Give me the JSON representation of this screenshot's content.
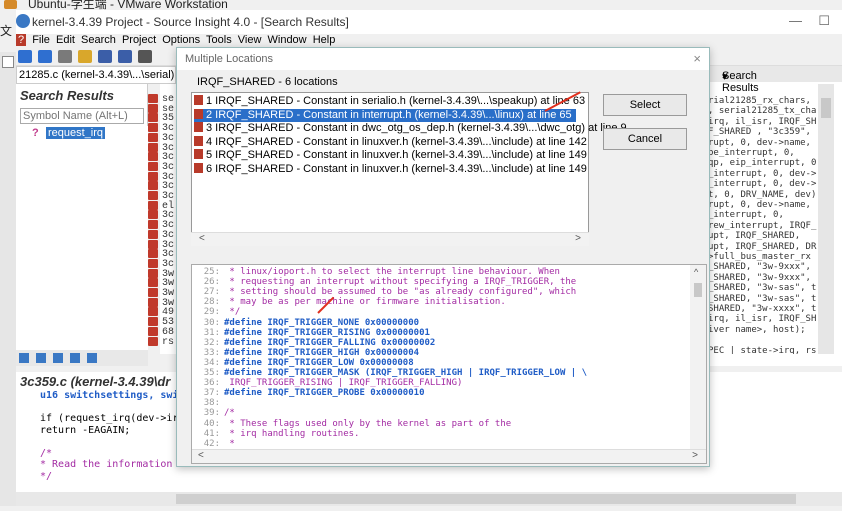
{
  "vm": {
    "title": "Ubuntu-学生端 - VMware Workstation"
  },
  "side_char": "文",
  "window": {
    "title": "kernel-3.4.39 Project - Source Insight 4.0 - [Search Results]",
    "minimize": "—",
    "maximize": "☐"
  },
  "menu": {
    "file_marker": "?",
    "items": [
      "File",
      "Edit",
      "Search",
      "Project",
      "Options",
      "Tools",
      "View",
      "Window",
      "Help"
    ]
  },
  "project_tab": "21285.c (kernel-3.4.39\\...\\serial)",
  "search_panel": {
    "title": "Search Results",
    "placeholder": "Symbol Name (Alt+L)",
    "item_icon": "?",
    "item_label": "request_irq"
  },
  "result_codes": [
    "se",
    "se",
    "35",
    "3c",
    "3c",
    "3c",
    "3c",
    "3c",
    "3c",
    "3c",
    "3c",
    "el",
    "3c",
    "3c",
    "3c",
    "3c",
    "3c",
    "3c",
    "3w",
    "3w",
    "3w",
    "3w",
    "49",
    "53",
    "68",
    "rs"
  ],
  "right_panel": {
    "tab_label": "Search Results",
    "tab_close": "×",
    "tab_menu": "▾",
    "code_lines": [
      "rial21285_rx_chars,",
      ", serial21285_tx_cha",
      "irq, il_isr, IRQF_SH",
      "F_SHARED , \"3c359\",",
      "rupt, 0, dev->name,",
      "be_interrupt, 0,",
      "qp, eip_interrupt, 0",
      "_interrupt, 0, dev->",
      "_interrupt, 0, dev->",
      "t, 0, DRV_NAME, dev)",
      "rupt, 0, dev->name,",
      "_interrupt, 0,",
      "rew_interrupt, IRQF_",
      "upt, IRQF_SHARED,",
      "upt, IRQF_SHARED, DR",
      ">full_bus_master_rx",
      "_SHARED, \"3w-9xxx\",",
      "_SHARED, \"3w-9xxx\",",
      "_SHARED, \"3w-sas\", t",
      "_SHARED, \"3w-sas\", t",
      "SHARED, \"3w-xxxx\", t",
      "irq, il_isr, IRQF_SH",
      "iver name>, host);",
      "",
      "PEC | state->irq, rs"
    ]
  },
  "editor": {
    "title": "3c359.c (kernel-3.4.39\\dr",
    "lines": [
      {
        "text": "u16 switchsettings, switchs",
        "kind": "decl"
      },
      {
        "text": "",
        "kind": "blank"
      },
      {
        "text": "if (request_irq(dev->irq, x",
        "kind": "code"
      },
      {
        "text": "    return -EAGAIN;",
        "kind": "code"
      },
      {
        "text": "",
        "kind": "blank"
      },
      {
        "text": "/*",
        "kind": "comment"
      },
      {
        "text": " * Read the information fro",
        "kind": "comment"
      },
      {
        "text": " */",
        "kind": "comment"
      }
    ]
  },
  "dialog": {
    "title": "Multiple Locations",
    "close": "×",
    "heading": "IRQF_SHARED - 6 locations",
    "locations": [
      "1 IRQF_SHARED - Constant in serialio.h (kernel-3.4.39\\...\\speakup) at line 63",
      "2 IRQF_SHARED - Constant in interrupt.h (kernel-3.4.39\\...\\linux) at line 65",
      "3 IRQF_SHARED - Constant in dwc_otg_os_dep.h (kernel-3.4.39\\...\\dwc_otg) at line 9",
      "4 IRQF_SHARED - Constant in linuxver.h (kernel-3.4.39\\...\\include) at line 142",
      "5 IRQF_SHARED - Constant in linuxver.h (kernel-3.4.39\\...\\include) at line 149",
      "6 IRQF_SHARED - Constant in linuxver.h (kernel-3.4.39\\...\\include) at line 149"
    ],
    "selected_index": 1,
    "select_label": "Select",
    "cancel_label": "Cancel",
    "preview": [
      {
        "ln": "25:",
        "text": " * linux/ioport.h to select the interrupt line behaviour.  When",
        "kind": "comment"
      },
      {
        "ln": "26:",
        "text": " * requesting an interrupt without specifying a IRQF_TRIGGER, the",
        "kind": "comment"
      },
      {
        "ln": "27:",
        "text": " * setting should be assumed to be \"as already configured\", which",
        "kind": "comment"
      },
      {
        "ln": "28:",
        "text": " * may be as per machine or firmware initialisation.",
        "kind": "comment"
      },
      {
        "ln": "29:",
        "text": " */",
        "kind": "comment"
      },
      {
        "ln": "30:",
        "text": "#define IRQF_TRIGGER_NONE   0x00000000",
        "kind": "define"
      },
      {
        "ln": "31:",
        "text": "#define IRQF_TRIGGER_RISING 0x00000001",
        "kind": "define"
      },
      {
        "ln": "32:",
        "text": "#define IRQF_TRIGGER_FALLING   0x00000002",
        "kind": "define"
      },
      {
        "ln": "33:",
        "text": "#define IRQF_TRIGGER_HIGH   0x00000004",
        "kind": "define"
      },
      {
        "ln": "34:",
        "text": "#define IRQF_TRIGGER_LOW    0x00000008",
        "kind": "define"
      },
      {
        "ln": "35:",
        "text": "#define IRQF_TRIGGER_MASK   (IRQF_TRIGGER_HIGH | IRQF_TRIGGER_LOW | \\",
        "kind": "define"
      },
      {
        "ln": "36:",
        "text": "                IRQF_TRIGGER_RISING | IRQF_TRIGGER_FALLING)",
        "kind": "cont"
      },
      {
        "ln": "37:",
        "text": "#define IRQF_TRIGGER_PROBE  0x00000010",
        "kind": "define"
      },
      {
        "ln": "38:",
        "text": "",
        "kind": "blank"
      },
      {
        "ln": "39:",
        "text": "/*",
        "kind": "comment"
      },
      {
        "ln": "40:",
        "text": " * These flags used only by the kernel as part of the",
        "kind": "comment"
      },
      {
        "ln": "41:",
        "text": " * irq handling routines.",
        "kind": "comment"
      },
      {
        "ln": "42:",
        "text": " *",
        "kind": "comment"
      }
    ]
  },
  "scroll_glyphs": {
    "left": "<",
    "right": ">",
    "down": "⌄",
    "up": "^"
  },
  "colors": {
    "accent_select": "#2a6fc9",
    "annotation_arrow": "#e0301e",
    "hash_icon": "#b83a2a"
  }
}
